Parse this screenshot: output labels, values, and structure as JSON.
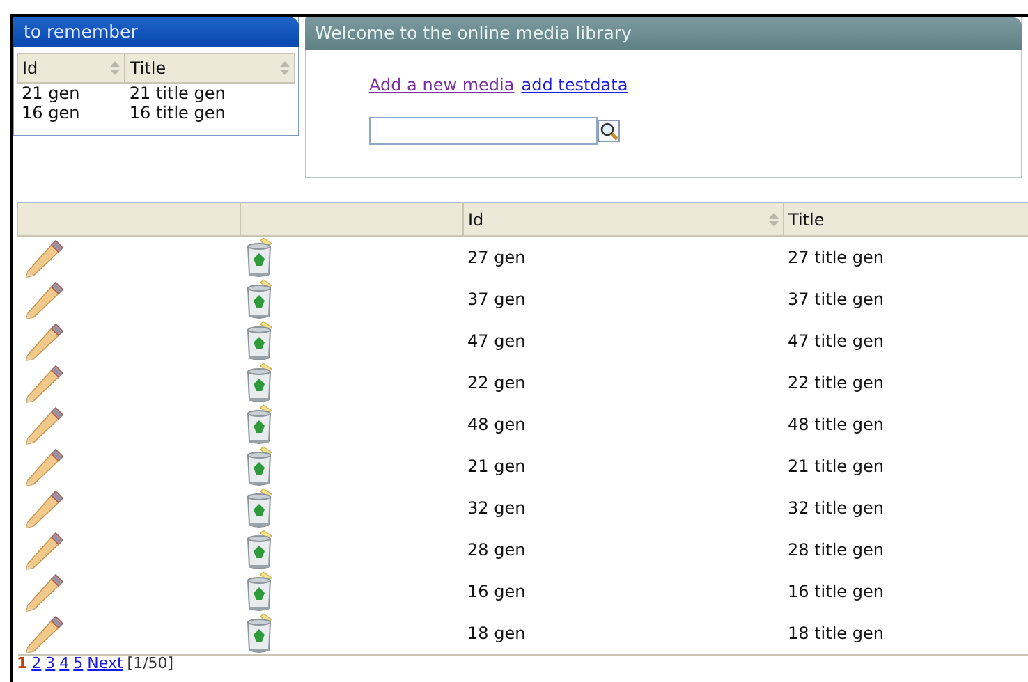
{
  "remember_panel": {
    "title": "to remember",
    "columns": [
      "Id",
      "Title"
    ],
    "rows": [
      [
        "21 gen",
        "21 title gen"
      ],
      [
        "16 gen",
        "16 title gen"
      ]
    ]
  },
  "welcome_panel": {
    "title": "Welcome to the online media library",
    "links": [
      {
        "label": "Add a new media",
        "visited": true
      },
      {
        "label": "add testdata",
        "visited": false
      }
    ]
  },
  "media_table": {
    "columns": [
      "",
      "",
      "Id",
      "Title"
    ],
    "rows": [
      [
        "27 gen",
        "27 title gen"
      ],
      [
        "37 gen",
        "37 title gen"
      ],
      [
        "47 gen",
        "47 title gen"
      ],
      [
        "22 gen",
        "22 title gen"
      ],
      [
        "48 gen",
        "48 title gen"
      ],
      [
        "21 gen",
        "21 title gen"
      ],
      [
        "32 gen",
        "32 title gen"
      ],
      [
        "28 gen",
        "28 title gen"
      ],
      [
        "16 gen",
        "16 title gen"
      ],
      [
        "18 gen",
        "18 title gen"
      ]
    ]
  },
  "pagination": {
    "pages": [
      {
        "label": "1",
        "selected": true
      },
      {
        "label": "2",
        "selected": false
      },
      {
        "label": "3",
        "selected": false
      },
      {
        "label": "4",
        "selected": false
      },
      {
        "label": "5",
        "selected": false
      }
    ],
    "next": "Next",
    "status": "[1/50]"
  }
}
